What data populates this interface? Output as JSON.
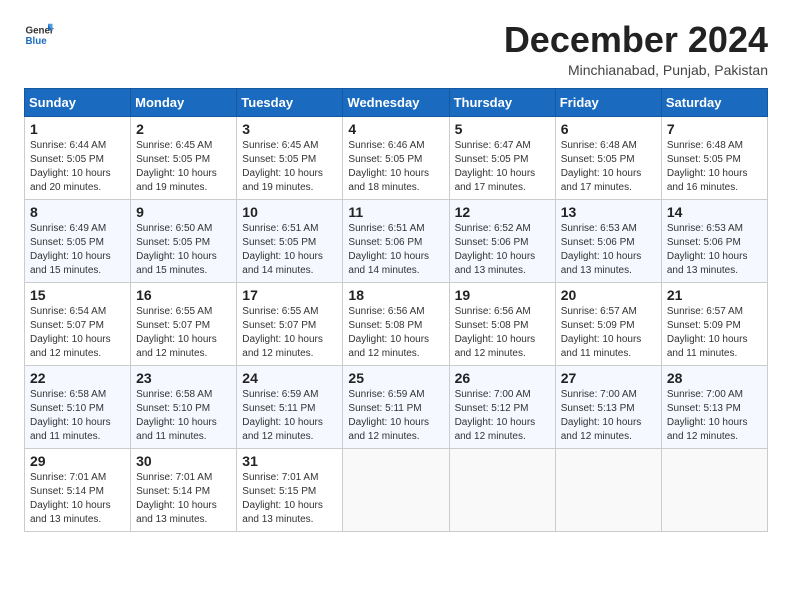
{
  "logo": {
    "line1": "General",
    "line2": "Blue"
  },
  "title": "December 2024",
  "subtitle": "Minchianabad, Punjab, Pakistan",
  "weekdays": [
    "Sunday",
    "Monday",
    "Tuesday",
    "Wednesday",
    "Thursday",
    "Friday",
    "Saturday"
  ],
  "weeks": [
    [
      {
        "day": 1,
        "info": "Sunrise: 6:44 AM\nSunset: 5:05 PM\nDaylight: 10 hours\nand 20 minutes."
      },
      {
        "day": 2,
        "info": "Sunrise: 6:45 AM\nSunset: 5:05 PM\nDaylight: 10 hours\nand 19 minutes."
      },
      {
        "day": 3,
        "info": "Sunrise: 6:45 AM\nSunset: 5:05 PM\nDaylight: 10 hours\nand 19 minutes."
      },
      {
        "day": 4,
        "info": "Sunrise: 6:46 AM\nSunset: 5:05 PM\nDaylight: 10 hours\nand 18 minutes."
      },
      {
        "day": 5,
        "info": "Sunrise: 6:47 AM\nSunset: 5:05 PM\nDaylight: 10 hours\nand 17 minutes."
      },
      {
        "day": 6,
        "info": "Sunrise: 6:48 AM\nSunset: 5:05 PM\nDaylight: 10 hours\nand 17 minutes."
      },
      {
        "day": 7,
        "info": "Sunrise: 6:48 AM\nSunset: 5:05 PM\nDaylight: 10 hours\nand 16 minutes."
      }
    ],
    [
      {
        "day": 8,
        "info": "Sunrise: 6:49 AM\nSunset: 5:05 PM\nDaylight: 10 hours\nand 15 minutes."
      },
      {
        "day": 9,
        "info": "Sunrise: 6:50 AM\nSunset: 5:05 PM\nDaylight: 10 hours\nand 15 minutes."
      },
      {
        "day": 10,
        "info": "Sunrise: 6:51 AM\nSunset: 5:05 PM\nDaylight: 10 hours\nand 14 minutes."
      },
      {
        "day": 11,
        "info": "Sunrise: 6:51 AM\nSunset: 5:06 PM\nDaylight: 10 hours\nand 14 minutes."
      },
      {
        "day": 12,
        "info": "Sunrise: 6:52 AM\nSunset: 5:06 PM\nDaylight: 10 hours\nand 13 minutes."
      },
      {
        "day": 13,
        "info": "Sunrise: 6:53 AM\nSunset: 5:06 PM\nDaylight: 10 hours\nand 13 minutes."
      },
      {
        "day": 14,
        "info": "Sunrise: 6:53 AM\nSunset: 5:06 PM\nDaylight: 10 hours\nand 13 minutes."
      }
    ],
    [
      {
        "day": 15,
        "info": "Sunrise: 6:54 AM\nSunset: 5:07 PM\nDaylight: 10 hours\nand 12 minutes."
      },
      {
        "day": 16,
        "info": "Sunrise: 6:55 AM\nSunset: 5:07 PM\nDaylight: 10 hours\nand 12 minutes."
      },
      {
        "day": 17,
        "info": "Sunrise: 6:55 AM\nSunset: 5:07 PM\nDaylight: 10 hours\nand 12 minutes."
      },
      {
        "day": 18,
        "info": "Sunrise: 6:56 AM\nSunset: 5:08 PM\nDaylight: 10 hours\nand 12 minutes."
      },
      {
        "day": 19,
        "info": "Sunrise: 6:56 AM\nSunset: 5:08 PM\nDaylight: 10 hours\nand 12 minutes."
      },
      {
        "day": 20,
        "info": "Sunrise: 6:57 AM\nSunset: 5:09 PM\nDaylight: 10 hours\nand 11 minutes."
      },
      {
        "day": 21,
        "info": "Sunrise: 6:57 AM\nSunset: 5:09 PM\nDaylight: 10 hours\nand 11 minutes."
      }
    ],
    [
      {
        "day": 22,
        "info": "Sunrise: 6:58 AM\nSunset: 5:10 PM\nDaylight: 10 hours\nand 11 minutes."
      },
      {
        "day": 23,
        "info": "Sunrise: 6:58 AM\nSunset: 5:10 PM\nDaylight: 10 hours\nand 11 minutes."
      },
      {
        "day": 24,
        "info": "Sunrise: 6:59 AM\nSunset: 5:11 PM\nDaylight: 10 hours\nand 12 minutes."
      },
      {
        "day": 25,
        "info": "Sunrise: 6:59 AM\nSunset: 5:11 PM\nDaylight: 10 hours\nand 12 minutes."
      },
      {
        "day": 26,
        "info": "Sunrise: 7:00 AM\nSunset: 5:12 PM\nDaylight: 10 hours\nand 12 minutes."
      },
      {
        "day": 27,
        "info": "Sunrise: 7:00 AM\nSunset: 5:13 PM\nDaylight: 10 hours\nand 12 minutes."
      },
      {
        "day": 28,
        "info": "Sunrise: 7:00 AM\nSunset: 5:13 PM\nDaylight: 10 hours\nand 12 minutes."
      }
    ],
    [
      {
        "day": 29,
        "info": "Sunrise: 7:01 AM\nSunset: 5:14 PM\nDaylight: 10 hours\nand 13 minutes."
      },
      {
        "day": 30,
        "info": "Sunrise: 7:01 AM\nSunset: 5:14 PM\nDaylight: 10 hours\nand 13 minutes."
      },
      {
        "day": 31,
        "info": "Sunrise: 7:01 AM\nSunset: 5:15 PM\nDaylight: 10 hours\nand 13 minutes."
      },
      null,
      null,
      null,
      null
    ]
  ]
}
